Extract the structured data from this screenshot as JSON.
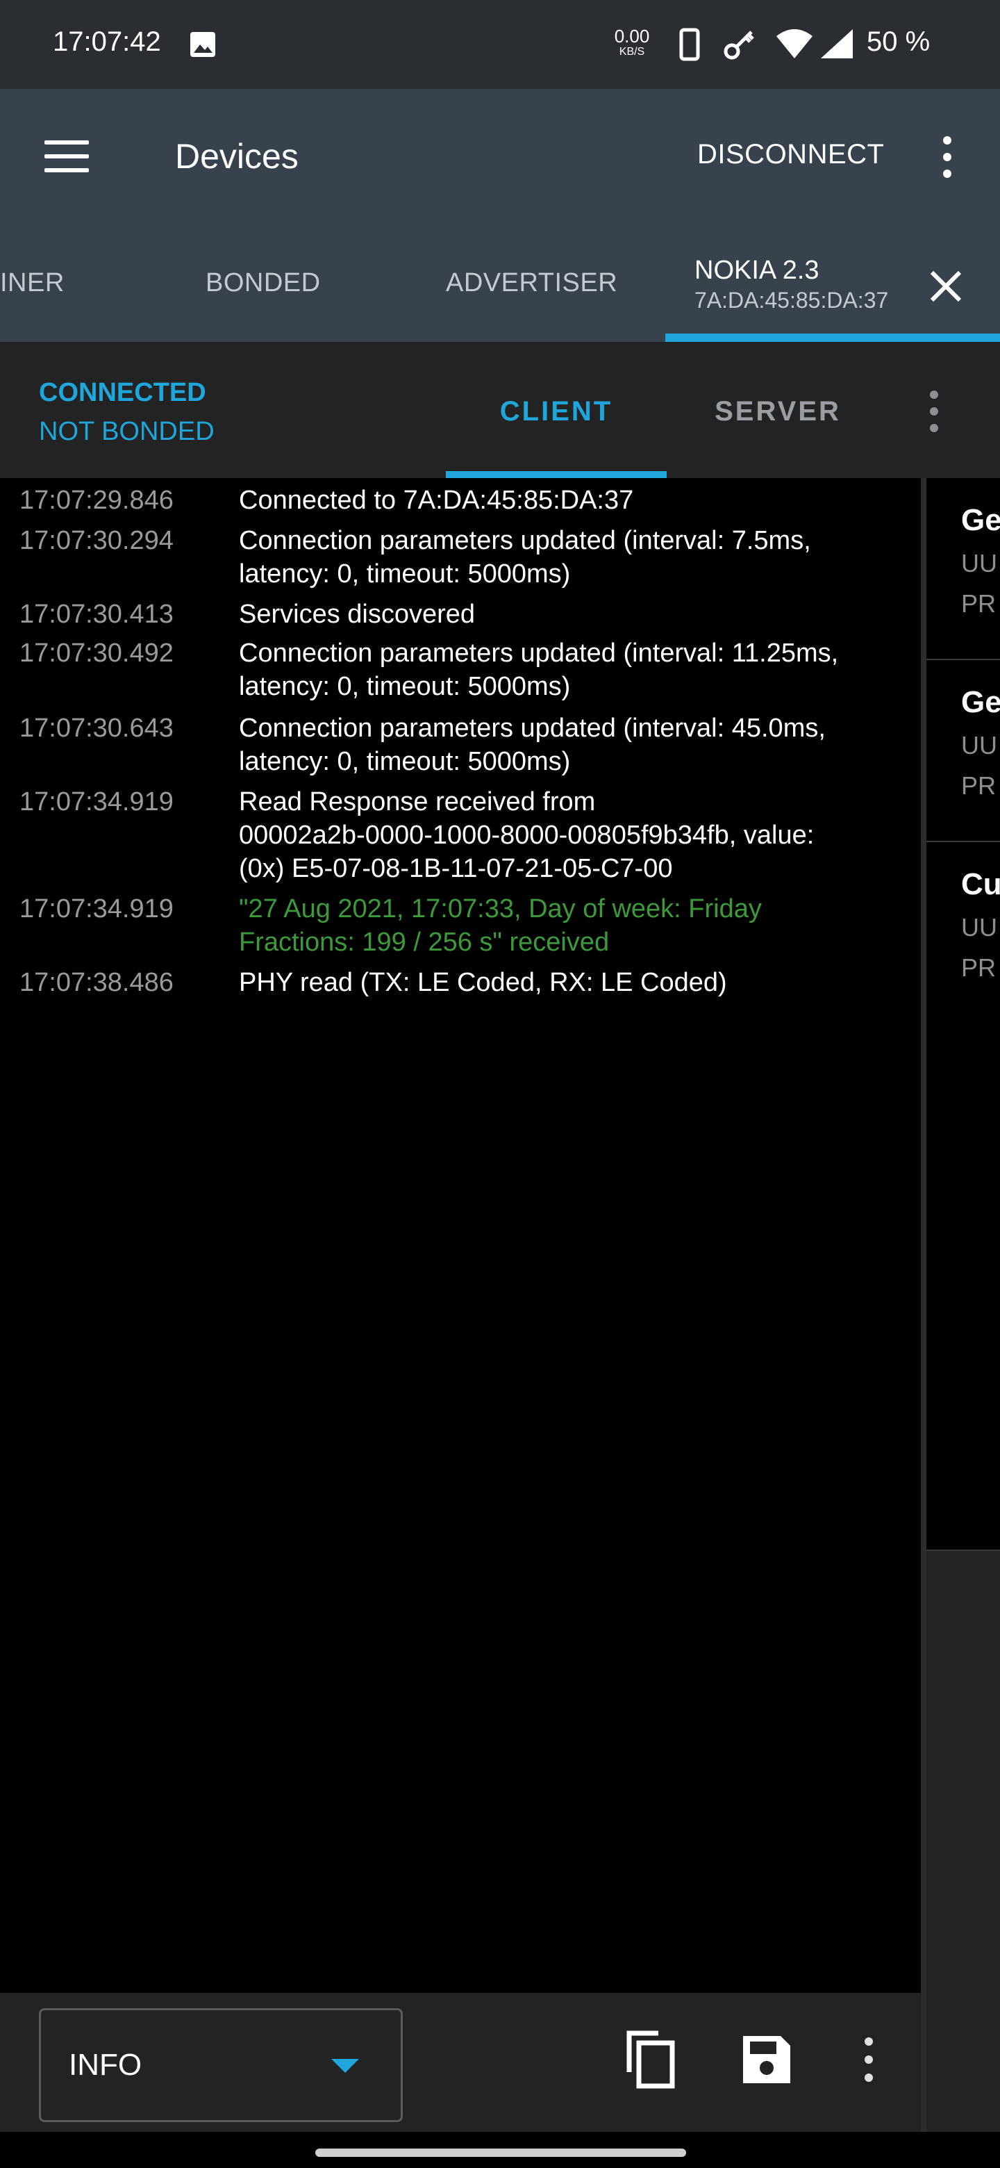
{
  "status_bar": {
    "time": "17:07:42",
    "net_speed_value": "0.00",
    "net_speed_unit": "KB/S",
    "battery": "50 %",
    "icons": [
      "image-icon",
      "phone-icon",
      "key-icon",
      "wifi-icon",
      "signal-icon"
    ]
  },
  "app_bar": {
    "title": "Devices",
    "disconnect_label": "DISCONNECT"
  },
  "device_tabs": {
    "scanner": "INER",
    "bonded": "BONDED",
    "advertiser": "ADVERTISER",
    "active": {
      "name": "NOKIA 2.3",
      "address": "7A:DA:45:85:DA:37"
    }
  },
  "connection": {
    "state": "CONNECTED",
    "bond_state": "NOT BONDED",
    "tab_client": "CLIENT",
    "tab_server": "SERVER"
  },
  "log": [
    {
      "time": "17:07:29.846",
      "message": "Connected to 7A:DA:45:85:DA:37"
    },
    {
      "time": "17:07:30.294",
      "message": "Connection parameters updated (interval: 7.5ms,\nlatency: 0, timeout: 5000ms)"
    },
    {
      "time": "17:07:30.413",
      "message": "Services discovered"
    },
    {
      "time": "17:07:30.492",
      "message": "Connection parameters updated (interval: 11.25ms,\nlatency: 0, timeout: 5000ms)"
    },
    {
      "time": "17:07:30.643",
      "message": "Connection parameters updated (interval: 45.0ms,\nlatency: 0, timeout: 5000ms)"
    },
    {
      "time": "17:07:34.919",
      "message": "Read Response received from\n00002a2b-0000-1000-8000-00805f9b34fb, value:\n(0x) E5-07-08-1B-11-07-21-05-C7-00"
    },
    {
      "time": "17:07:34.919",
      "message": "\"27 Aug 2021, 17:07:33, Day of week: Friday\nFractions: 199 / 256 s\" received",
      "highlight": true
    },
    {
      "time": "17:07:38.486",
      "message": "PHY read (TX: LE Coded, RX: LE Coded)"
    }
  ],
  "services": [
    {
      "title": "Ge",
      "uuid": "UU",
      "prop": "PR"
    },
    {
      "title": "Ge",
      "uuid": "UU",
      "prop": "PR"
    },
    {
      "title": "Cu",
      "uuid": "UU",
      "prop": "PR"
    }
  ],
  "bottom_bar": {
    "log_level": "INFO"
  },
  "colors": {
    "accent": "#1fa7dc",
    "appbar": "#37424c",
    "log_highlight": "#3d9a3a"
  }
}
